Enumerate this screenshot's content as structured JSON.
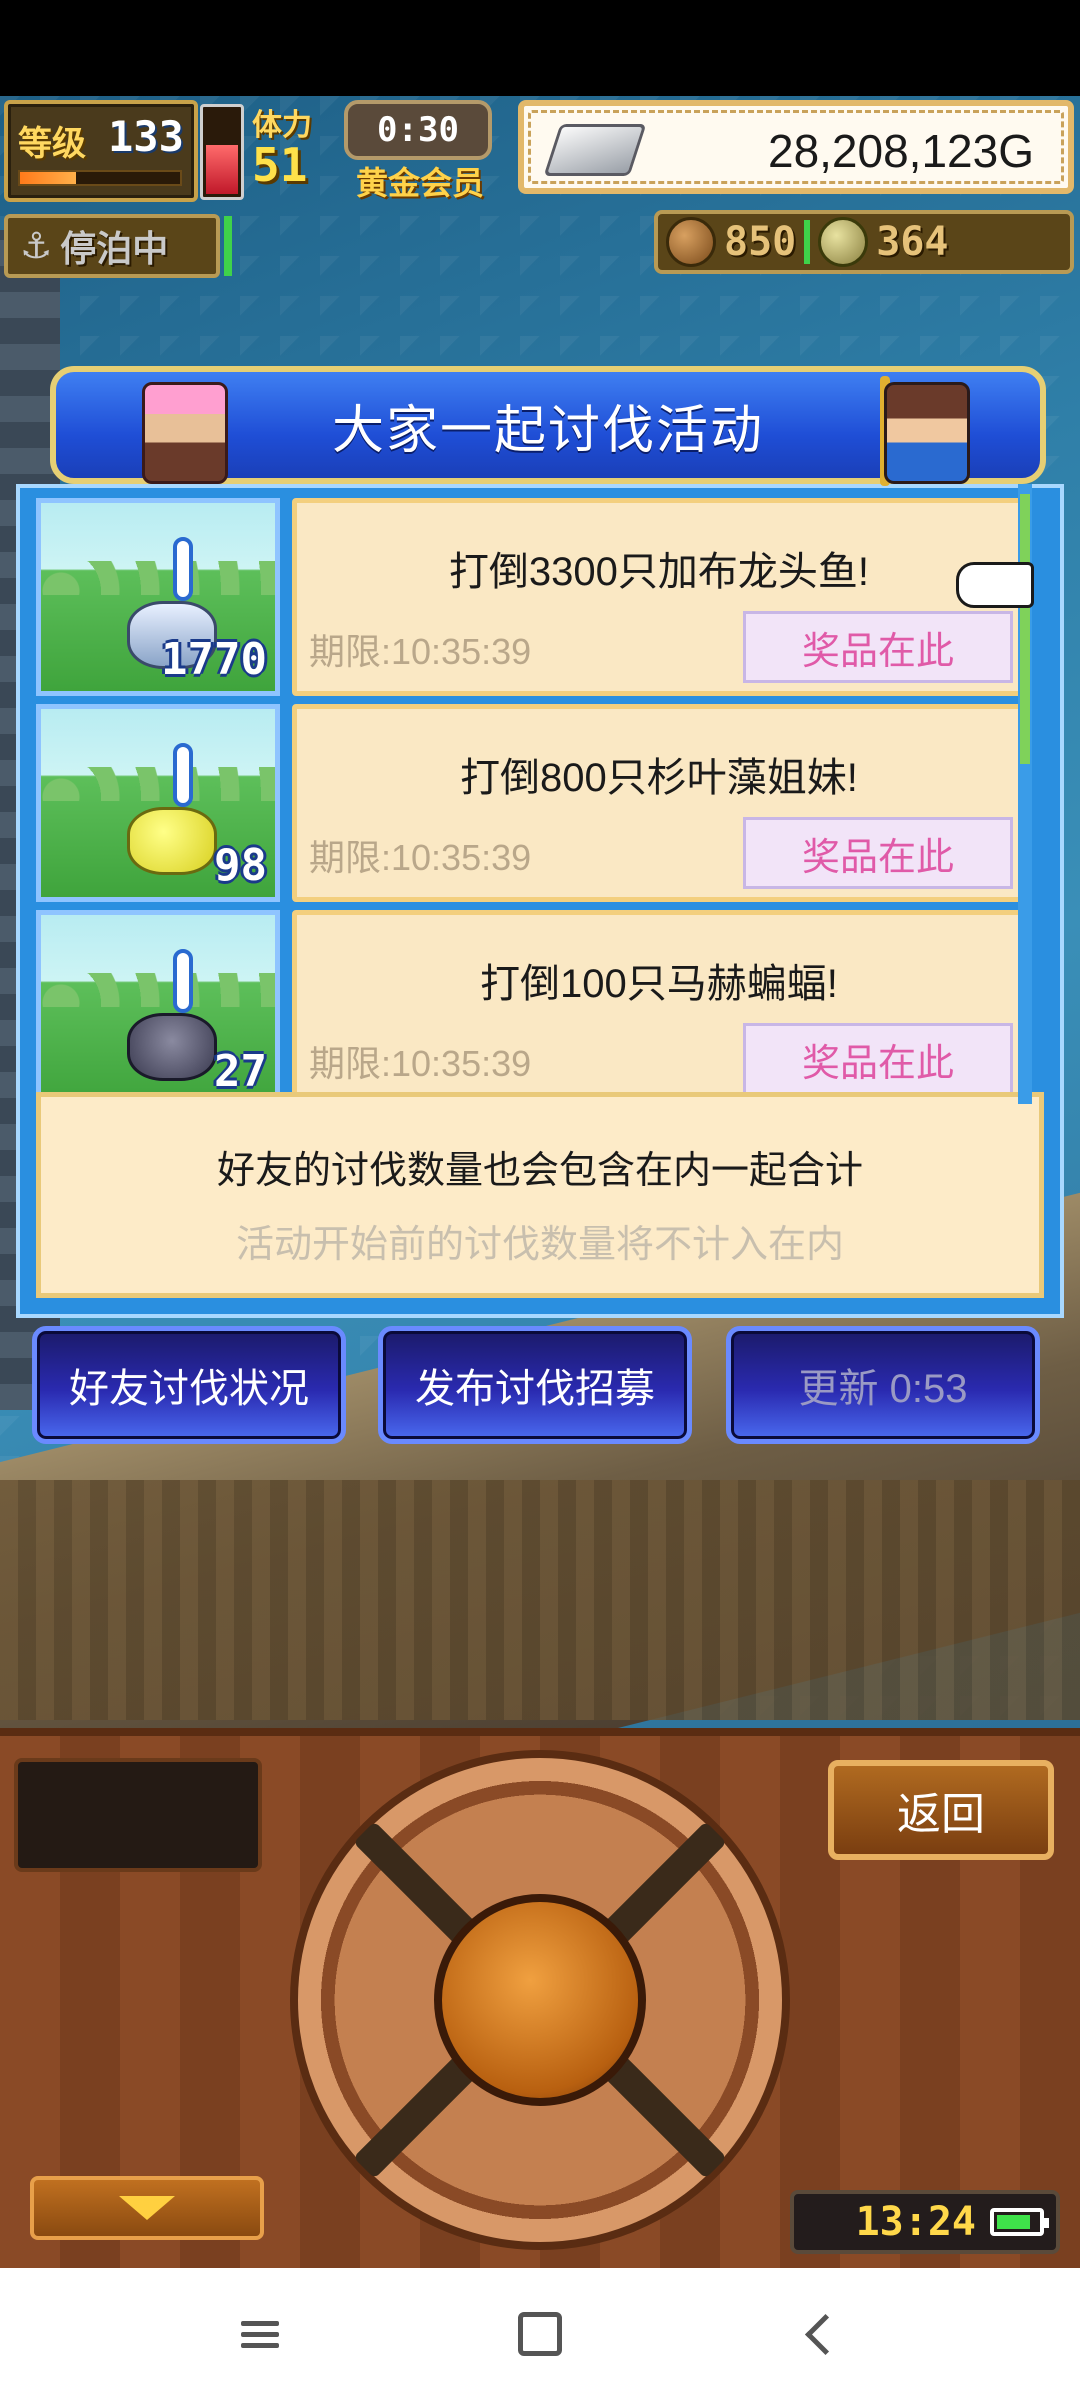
{
  "hud": {
    "level_label": "等级",
    "level_value": "133",
    "level_progress": 0.35,
    "stamina_label": "体力",
    "stamina_value": "51",
    "stamina_gauge": 0.55,
    "timer": "0:30",
    "vip_label": "黄金会员",
    "money": "28,208,123G",
    "dock_status": "停泊中",
    "seeds": "850",
    "coins": "364"
  },
  "event": {
    "title": "大家一起讨伐活动",
    "missions": [
      {
        "title": "打倒3300只加布龙头鱼!",
        "deadline": "期限:10:35:39",
        "prize_label": "奖品在此",
        "count": "1770",
        "monster": "fish"
      },
      {
        "title": "打倒800只杉叶藻姐妹!",
        "deadline": "期限:10:35:39",
        "prize_label": "奖品在此",
        "count": "98",
        "monster": "slime"
      },
      {
        "title": "打倒100只马赫蝙蝠!",
        "deadline": "期限:10:35:39",
        "prize_label": "奖品在此",
        "count": "27",
        "monster": "bat"
      }
    ],
    "info_main": "好友的讨伐数量也会包含在内一起合计",
    "info_sub": "活动开始前的讨伐数量将不计入在内"
  },
  "actions": {
    "friends_status": "好友讨伐状况",
    "recruit": "发布讨伐招募",
    "refresh": "更新 0:53"
  },
  "controls": {
    "back_label": "返回",
    "clock": "13:24",
    "battery_level": 0.85
  },
  "colors": {
    "panel_blue": "#2a8fe0",
    "card_bg": "#fae8c4",
    "prize_pink": "#e05aa8",
    "hud_gold": "#ffe07a"
  }
}
